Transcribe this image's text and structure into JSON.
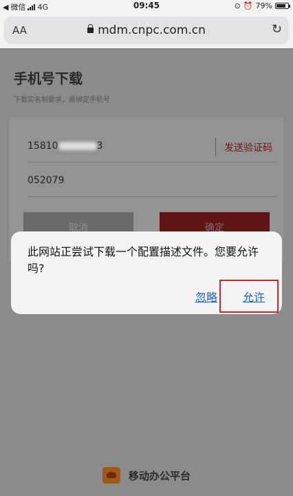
{
  "status_bar": {
    "carrier": "微信",
    "network": "4G",
    "time": "09:45",
    "battery": "79%",
    "battery_level": 0.79
  },
  "browser": {
    "text_size_label": "AA",
    "url": "mdm.cnpc.com.cn"
  },
  "page": {
    "title": "手机号下载",
    "subtitle": "下载实名制要求，需绑定手机号",
    "phone_value": "15810",
    "phone_suffix": "3",
    "send_code_label": "发送验证码",
    "code_value": "052079",
    "cancel_label": "取消",
    "confirm_label": "确定",
    "footer_label": "移动办公平台"
  },
  "alert": {
    "message": "此网站正尝试下载一个配置描述文件。您要允许吗?",
    "ignore_label": "忽略",
    "allow_label": "允许"
  },
  "colors": {
    "link": "#1a5fd6",
    "highlight": "#e02020",
    "brand_red": "#5e1414"
  }
}
